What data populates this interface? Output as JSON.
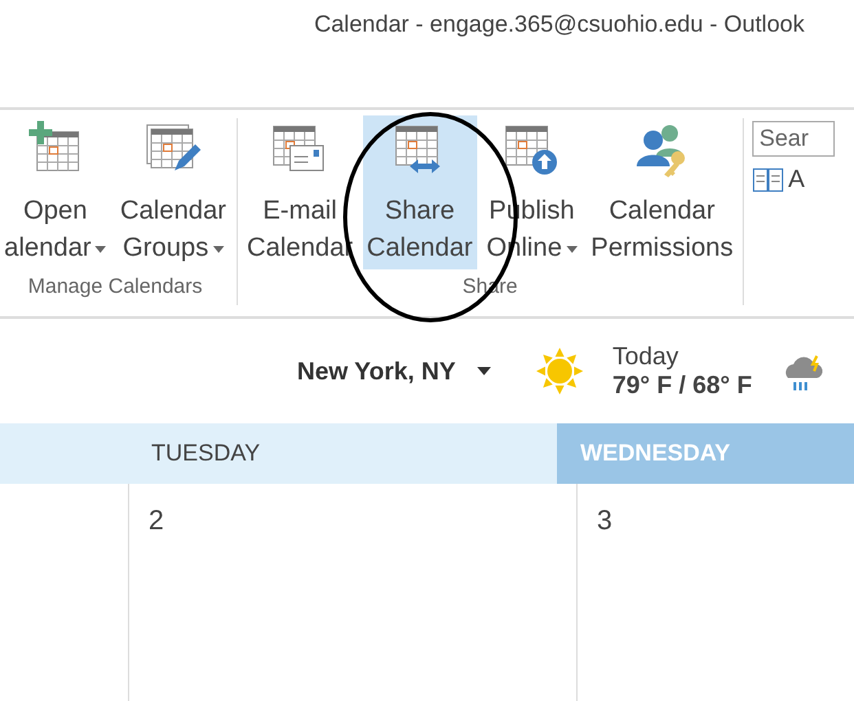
{
  "window": {
    "title": "Calendar - engage.365@csuohio.edu - Outlook"
  },
  "ribbon": {
    "groups": [
      {
        "label": "Manage Calendars",
        "buttons": [
          {
            "kind": "open",
            "lines": [
              "Open",
              "alendar"
            ],
            "dropdown": true,
            "selected": false
          },
          {
            "kind": "groups",
            "lines": [
              "Calendar",
              "Groups"
            ],
            "dropdown": true,
            "selected": false
          }
        ]
      },
      {
        "label": "Share",
        "buttons": [
          {
            "kind": "email",
            "lines": [
              "E-mail",
              "Calendar"
            ],
            "dropdown": false,
            "selected": false
          },
          {
            "kind": "share",
            "lines": [
              "Share",
              "Calendar"
            ],
            "dropdown": false,
            "selected": true
          },
          {
            "kind": "publish",
            "lines": [
              "Publish",
              "Online"
            ],
            "dropdown": true,
            "selected": false
          },
          {
            "kind": "permissions",
            "lines": [
              "Calendar",
              "Permissions"
            ],
            "dropdown": false,
            "selected": false
          }
        ]
      }
    ],
    "search": {
      "placeholder": "Sear"
    },
    "address_book": {
      "label": "A"
    }
  },
  "annotation": {
    "kind": "ellipse"
  },
  "weather": {
    "location": "New York, NY",
    "day": "Today",
    "temps": "79° F / 68° F"
  },
  "calendar": {
    "days": [
      {
        "name": "TUESDAY",
        "date": "2",
        "selected": false
      },
      {
        "name": "WEDNESDAY",
        "date": "3",
        "selected": true
      }
    ]
  }
}
